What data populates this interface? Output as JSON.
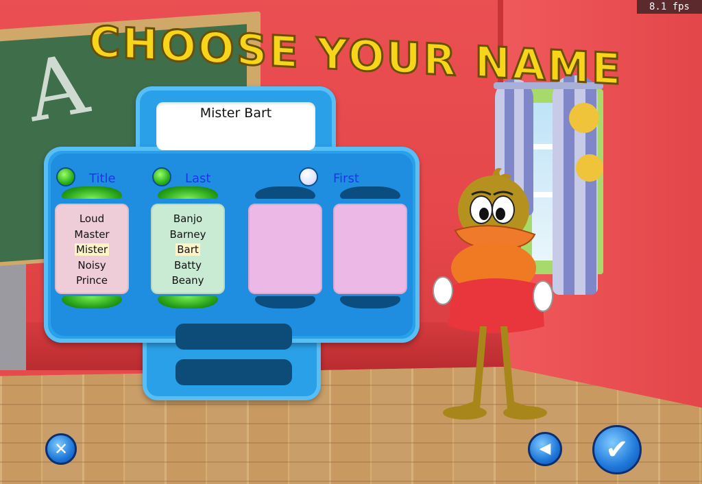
{
  "hud": {
    "fps": "8.1 fps"
  },
  "screen": {
    "title": "CHOOSE YOUR NAME"
  },
  "name_display": "Mister Bart",
  "columns": [
    {
      "label": "Title",
      "selected": true,
      "items": [
        "Loud",
        "Master",
        "Mister",
        "Noisy",
        "Prince"
      ],
      "highlighted": "Mister",
      "color": "#eeccd8"
    },
    {
      "label": "Last",
      "selected": true,
      "items": [
        "Banjo",
        "Barney",
        "Bart",
        "Batty",
        "Beany"
      ],
      "highlighted": "Bart",
      "color": "#c9ead3"
    },
    {
      "label": "",
      "selected": false,
      "items": [],
      "color": "#ecb8e6"
    },
    {
      "label": "First",
      "selected": false,
      "items": [],
      "color": "#ecb8e6"
    }
  ],
  "buttons": {
    "cancel_icon": "close-x-icon",
    "back_icon": "back-arrow-icon",
    "confirm_icon": "checkmark-icon"
  },
  "colors": {
    "panel": "#2aa0e8",
    "title": "#f7d51a",
    "label": "#1c36e6",
    "wall": "#e64a4d"
  }
}
